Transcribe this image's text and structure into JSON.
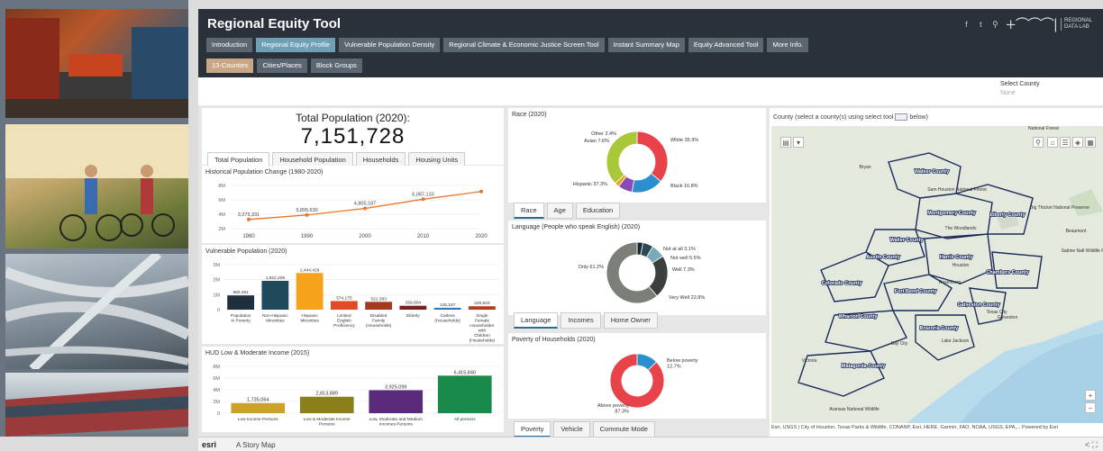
{
  "header": {
    "title": "Regional Equity Tool"
  },
  "social": {
    "facebook": "f",
    "twitter": "t",
    "link": "⚲"
  },
  "logo": {
    "mark": "+⌒⌒⌒|",
    "line1": "REGIONAL",
    "line2": "DATA LAB"
  },
  "tabs_main": [
    {
      "label": "Introduction"
    },
    {
      "label": "Regional Equity Profile"
    },
    {
      "label": "Vulnerable Population Density"
    },
    {
      "label": "Regional Climate & Economic Justice Screen Tool"
    },
    {
      "label": "Instant Summary Map"
    },
    {
      "label": "Equity Advanced Tool"
    },
    {
      "label": "More Info."
    }
  ],
  "tabs_geo": [
    {
      "label": "13-Counties"
    },
    {
      "label": "Cities/Places"
    },
    {
      "label": "Block Groups"
    }
  ],
  "select_county": {
    "label": "Select County",
    "value": "None"
  },
  "total": {
    "label": "Total Population (2020):",
    "value": "7,151,728"
  },
  "pop_tabs": [
    "Total Population",
    "Household Population",
    "Households",
    "Housing Units"
  ],
  "colors": {
    "header": "#2a313a",
    "tab": "#5b6670",
    "tab_active": "#6f9fb5",
    "line": "#e8772e"
  },
  "charts": {
    "historical": {
      "title": "Historical Population Change (1980-2020)",
      "chart_data": {
        "type": "line",
        "x": [
          "1980",
          "1990",
          "2000",
          "2010",
          "2020"
        ],
        "values": [
          3275331,
          3895630,
          4805187,
          6087133,
          7151728
        ],
        "labels": [
          "3,275,331",
          "3,895,630",
          "4,805,187",
          "6,087,133",
          ""
        ],
        "ticks": [
          "8M",
          "6M",
          "4M",
          "2M"
        ],
        "ylim": [
          2000000,
          8000000
        ]
      }
    },
    "vulnerable": {
      "title": "Vulnerable Population (2020)",
      "chart_data": {
        "type": "bar",
        "categories": [
          "Population in Poverty",
          "Non-Hispanic Minorities",
          "Hispanic Minorities",
          "Limited English Proficiency",
          "Disabled Family (Households)",
          "Elderly",
          "Carless (Households)",
          "Single Female Householder with Children (Households)"
        ],
        "values": [
          950461,
          1922209,
          2444429,
          574175,
          521383,
          259904,
          125167,
          226603
        ],
        "labels": [
          "950,461",
          "1,922,209",
          "2,444,429",
          "574,175",
          "521,383",
          "259,904",
          "125,167",
          "226,603"
        ],
        "colors": [
          "#1f2f3d",
          "#1e4a5c",
          "#f5a31a",
          "#e24a26",
          "#a33a1f",
          "#7a1f1f",
          "#2a7ac0",
          "#b43a1a"
        ],
        "ticks": [
          "3M",
          "2M",
          "1M",
          "0"
        ],
        "ylim": [
          0,
          3000000
        ]
      }
    },
    "hud": {
      "title": "HUD Low & Moderate Income (2015)",
      "chart_data": {
        "type": "bar",
        "categories": [
          "Low Income Persons",
          "Low & Moderate Income Persons",
          "Low, Moderate and Medium Incomes Persons",
          "All persons"
        ],
        "values": [
          1735064,
          2813889,
          3925099,
          6415840
        ],
        "labels": [
          "1,735,064",
          "2,813,889",
          "3,925,099",
          "6,415,840"
        ],
        "colors": [
          "#c9a22a",
          "#8a7f1a",
          "#5a2b7a",
          "#1a8a4a"
        ],
        "ticks": [
          "8M",
          "6M",
          "4M",
          "2M",
          "0"
        ],
        "ylim": [
          0,
          8000000
        ]
      }
    },
    "race": {
      "title": "Race (2020)",
      "chart_data": {
        "type": "pie",
        "categories": [
          "White",
          "Black",
          "Asian",
          "Other",
          "Hispanic"
        ],
        "values": [
          35.9,
          16.8,
          7.6,
          2.4,
          37.3
        ],
        "labels": [
          "White 35.9%",
          "Black 16.8%",
          "Asian 7.6%",
          "Other 2.4%",
          "Hispanic 37.3%"
        ],
        "colors": [
          "#e8424a",
          "#2b8fcf",
          "#8a4ab8",
          "#f0a020",
          "#a8c83a"
        ]
      }
    },
    "language": {
      "title": "Language (People who speak English) (2020)",
      "chart_data": {
        "type": "pie",
        "categories": [
          "Not at all",
          "Not well",
          "Well",
          "Very Well",
          "Only"
        ],
        "values": [
          3.1,
          5.5,
          7.3,
          22.8,
          61.2
        ],
        "labels": [
          "Not at all 3.1%",
          "Not well 5.5%",
          "Well 7.3%",
          "Very Well 22.8%",
          "Only 61.2%"
        ],
        "colors": [
          "#1a2630",
          "#2a4a56",
          "#78aab8",
          "#3a4040",
          "#7a7f78"
        ]
      }
    },
    "poverty": {
      "title": "Poverty of Households (2020)",
      "chart_data": {
        "type": "pie",
        "categories": [
          "Below poverty",
          "Above poverty"
        ],
        "values": [
          12.7,
          87.3
        ],
        "labels": [
          "Below poverty 12.7%",
          "Above poverty 87.3%"
        ],
        "colors": [
          "#2b8fcf",
          "#e8424a"
        ]
      }
    }
  },
  "race_tabs": [
    "Race",
    "Age",
    "Education"
  ],
  "lang_tabs": [
    "Language",
    "Incomes",
    "Home Owner"
  ],
  "pov_tabs": [
    "Poverty",
    "Vehicle",
    "Commute Mode"
  ],
  "map": {
    "title_pre": "County (select a county(s) using select tool",
    "title_post": "below)",
    "labels": [
      "Walker County",
      "Montgomery County",
      "Liberty County",
      "Waller County",
      "Austin County",
      "Harris County",
      "Chambers County",
      "Colorado County",
      "Fort Bend County",
      "Galveston County",
      "Wharton County",
      "Brazoria County",
      "Matagorda County",
      "Houston",
      "Bryan",
      "The Woodlands",
      "Rosenberg",
      "Beaumont",
      "Victoria",
      "Lake Jackson",
      "Bay City",
      "Texas City",
      "Galveston",
      "National Forest",
      "Sam Houston National Forest",
      "Big Thicket National Preserve",
      "Sabine Natl Wildlife Refuge",
      "Aransas National Wildlife"
    ],
    "attribution": "Esri, USGS | City of Houston, Texas Parks & Wildlife, CONANP, Esri, HERE, Garmin, FAO, NOAA, USGS, EPA,...   Powered by Esri",
    "zoom_in": "+",
    "zoom_out": "−"
  },
  "footer": {
    "brand": "esri",
    "text": "A Story Map",
    "icons": "< ⛶"
  }
}
